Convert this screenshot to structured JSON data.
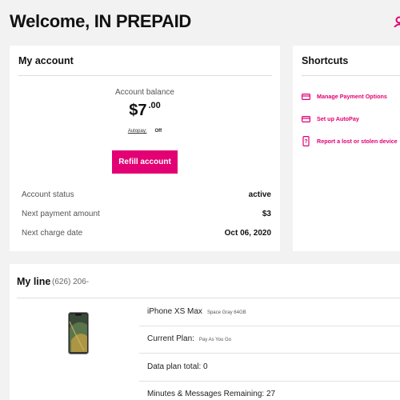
{
  "header": {
    "welcome": "Welcome, IN PREPAID"
  },
  "account": {
    "title": "My account",
    "balance_label": "Account balance",
    "balance_dollars": "$7",
    "balance_cents": ".00",
    "autopay_label": "Autopay:",
    "autopay_value": "Off",
    "refill_label": "Refill account",
    "rows": [
      {
        "label": "Account status",
        "value": "active"
      },
      {
        "label": "Next payment amount",
        "value": "$3"
      },
      {
        "label": "Next charge date",
        "value": "Oct 06, 2020"
      }
    ]
  },
  "shortcuts": {
    "title": "Shortcuts",
    "items": [
      {
        "label": "Manage Payment Options",
        "icon": "credit-card-icon"
      },
      {
        "label": "Set up AutoPay",
        "icon": "credit-card-icon"
      },
      {
        "label": "Report a lost or stolen device",
        "icon": "phone-alert-icon"
      }
    ]
  },
  "line": {
    "title": "My line",
    "phone": "(626) 206-",
    "device_name": "iPhone XS Max",
    "device_detail": "Space Gray 64GB",
    "plan_label": "Current Plan:",
    "plan_value": "Pay As You Go",
    "data_plan": "Data plan total: 0",
    "minutes": "Minutes & Messages Remaining: 27"
  },
  "colors": {
    "brand": "#e20074",
    "background": "#f2f2f2"
  }
}
